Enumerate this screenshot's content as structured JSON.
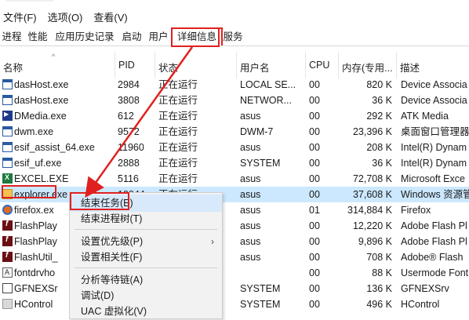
{
  "menubar": {
    "items": [
      "文件(F)",
      "选项(O)",
      "查看(V)"
    ]
  },
  "tabs": [
    {
      "label": "进程"
    },
    {
      "label": "性能"
    },
    {
      "label": "应用历史记录"
    },
    {
      "label": "启动"
    },
    {
      "label": "用户"
    },
    {
      "label": "详细信息",
      "active": true
    },
    {
      "label": "服务"
    }
  ],
  "columns": [
    "名称",
    "PID",
    "状态",
    "用户名",
    "CPU",
    "内存(专用...",
    "描述"
  ],
  "rows": [
    {
      "icon": "app-window-icon",
      "name": "dasHost.exe",
      "pid": "2984",
      "status": "正在运行",
      "user": "LOCAL SE...",
      "cpu": "00",
      "mem": "820 K",
      "desc": "Device Associa"
    },
    {
      "icon": "app-window-icon",
      "name": "dasHost.exe",
      "pid": "3808",
      "status": "正在运行",
      "user": "NETWOR...",
      "cpu": "00",
      "mem": "36 K",
      "desc": "Device Associa"
    },
    {
      "icon": "dmedia-icon",
      "name": "DMedia.exe",
      "pid": "612",
      "status": "正在运行",
      "user": "asus",
      "cpu": "00",
      "mem": "292 K",
      "desc": "ATK Media"
    },
    {
      "icon": "app-window-icon",
      "name": "dwm.exe",
      "pid": "9572",
      "status": "正在运行",
      "user": "DWM-7",
      "cpu": "00",
      "mem": "23,396 K",
      "desc": "桌面窗口管理器"
    },
    {
      "icon": "app-window-icon",
      "name": "esif_assist_64.exe",
      "pid": "11960",
      "status": "正在运行",
      "user": "asus",
      "cpu": "00",
      "mem": "208 K",
      "desc": "Intel(R) Dynam"
    },
    {
      "icon": "app-window-icon",
      "name": "esif_uf.exe",
      "pid": "2888",
      "status": "正在运行",
      "user": "SYSTEM",
      "cpu": "00",
      "mem": "36 K",
      "desc": "Intel(R) Dynam"
    },
    {
      "icon": "excel-icon",
      "name": "EXCEL.EXE",
      "pid": "5116",
      "status": "正在运行",
      "user": "asus",
      "cpu": "00",
      "mem": "72,708 K",
      "desc": "Microsoft Exce"
    },
    {
      "icon": "explorer-icon",
      "name": "explorer.exe",
      "pid": "10044",
      "status": "正在运行",
      "user": "asus",
      "cpu": "00",
      "mem": "37,608 K",
      "desc": "Windows 资源管",
      "selected": true
    },
    {
      "icon": "firefox-icon",
      "name": "firefox.ex",
      "pid": "",
      "status": "",
      "user": "asus",
      "cpu": "01",
      "mem": "314,884 K",
      "desc": "Firefox"
    },
    {
      "icon": "flash-icon",
      "name": "FlashPlay",
      "pid": "",
      "status": "",
      "user": "asus",
      "cpu": "00",
      "mem": "12,220 K",
      "desc": "Adobe Flash Pl"
    },
    {
      "icon": "flash-icon",
      "name": "FlashPlay",
      "pid": "",
      "status": "",
      "user": "asus",
      "cpu": "00",
      "mem": "9,896 K",
      "desc": "Adobe Flash Pl"
    },
    {
      "icon": "flash-icon",
      "name": "FlashUtil_",
      "pid": "",
      "status": "",
      "user": "asus",
      "cpu": "00",
      "mem": "708 K",
      "desc": "Adobe® Flash"
    },
    {
      "icon": "font-driver-icon",
      "name": "fontdrvho",
      "pid": "",
      "status": "",
      "user": "",
      "cpu": "00",
      "mem": "88 K",
      "desc": "Usermode Font"
    },
    {
      "icon": "nvidia-icon",
      "name": "GFNEXSr",
      "pid": "",
      "status": "",
      "user": "SYSTEM",
      "cpu": "00",
      "mem": "136 K",
      "desc": "GFNEXSrv"
    },
    {
      "icon": "hcontrol-icon",
      "name": "HControl",
      "pid": "",
      "status": "",
      "user": "SYSTEM",
      "cpu": "00",
      "mem": "496 K",
      "desc": "HControl"
    }
  ],
  "context_menu": {
    "items": [
      {
        "label": "结束任务(E)",
        "highlighted": true
      },
      {
        "label": "结束进程树(T)"
      },
      {
        "sep": true
      },
      {
        "label": "设置优先级(P)",
        "submenu": true
      },
      {
        "label": "设置相关性(F)"
      },
      {
        "sep": true
      },
      {
        "label": "分析等待链(A)"
      },
      {
        "label": "调试(D)"
      },
      {
        "label": "UAC 虚拟化(V)"
      }
    ]
  },
  "colors": {
    "annotation_red": "#e0201f",
    "selected_row": "#cce8ff",
    "menu_highlight": "#d7e9fb"
  }
}
